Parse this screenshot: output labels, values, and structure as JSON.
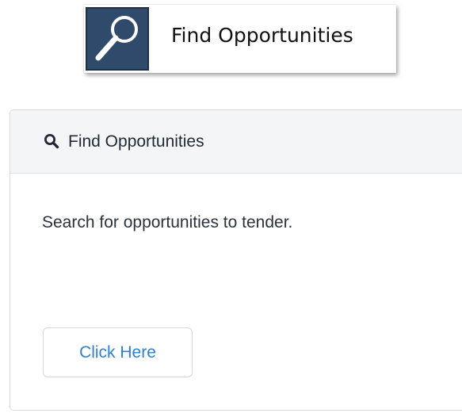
{
  "banner": {
    "title": "Find Opportunities",
    "icon": "magnifying-glass-icon",
    "icon_bg_color": "#2f4a6b"
  },
  "card": {
    "header": {
      "icon": "search-icon",
      "title": "Find Opportunities"
    },
    "description": "Search for opportunities to tender.",
    "button_label": "Click Here",
    "button_text_color": "#2f7fd1"
  }
}
